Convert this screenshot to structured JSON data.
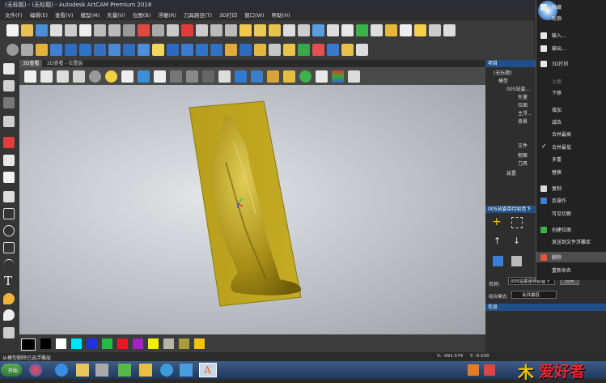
{
  "window": {
    "title": "(无标题) - (无标题) - Autodesk ArtCAM Premium 2018"
  },
  "menu": [
    "文件(F)",
    "编辑(E)",
    "查看(V)",
    "模型(M)",
    "矢量(V)",
    "位图(B)",
    "浮雕(R)",
    "刀具路径(T)",
    "3D打印",
    "窗口(W)",
    "帮助(H)"
  ],
  "view_tabs": [
    "3D查看",
    "2D查看 - 位置层"
  ],
  "left_tool_icons": [
    "select-arrow-icon",
    "node-edit-icon",
    "transform-icon",
    "grid-icon",
    "pen-icon",
    "eraser-icon",
    "camera-icon",
    "arc-icon",
    "rectangle-icon",
    "ellipse-icon",
    "polygon-icon",
    "curve-icon",
    "text-icon",
    "fill-icon",
    "drop-icon",
    "brush-icon"
  ],
  "palette": {
    "colors": [
      "#000000",
      "#ffffff",
      "#00e5ff",
      "#2233dd",
      "#22bb44",
      "#e21b22",
      "#a521c4",
      "#f2ee00",
      "#b8b4a8",
      "#a89c3c",
      "#f0c400"
    ]
  },
  "status": {
    "left": "从模型删除已选浮雕层",
    "coords": "X: -091.574     Y: -0.030"
  },
  "project_panel": {
    "title": "项目",
    "items": [
      "(无标题)",
      "模型",
      "005站姿...",
      "矢量",
      "位图",
      "主浮...",
      "背景",
      "文件",
      "侧面",
      "刀具",
      "装置"
    ]
  },
  "relief_panel": {
    "title": "005站姿苗侍如音下",
    "name_label": "名称:",
    "name_value": "005站姿苗侍如音下",
    "apply_button": "应用",
    "combine_label": "组合模式:",
    "combine_value": "合并最低"
  },
  "info_panel": {
    "title": "信息"
  },
  "context_menu": [
    {
      "label": "隐藏",
      "icon": "hide-icon"
    },
    {
      "label": "轮廓",
      "icon": "outline-icon"
    },
    {
      "label": "输入...",
      "icon": "import-icon"
    },
    {
      "label": "输出...",
      "icon": "export-icon"
    },
    {
      "label": "3D打印",
      "icon": "3d-print-icon"
    },
    {
      "label": "上移",
      "icon": "",
      "disabled": true
    },
    {
      "label": "下移",
      "icon": ""
    },
    {
      "label": "增加",
      "icon": ""
    },
    {
      "label": "减去",
      "icon": ""
    },
    {
      "label": "合并最高",
      "icon": ""
    },
    {
      "label": "合并最低",
      "icon": "check-icon"
    },
    {
      "label": "多重",
      "icon": ""
    },
    {
      "label": "替换",
      "icon": ""
    },
    {
      "label": "复制",
      "icon": "copy-icon"
    },
    {
      "label": "反操作",
      "icon": "invert-icon"
    },
    {
      "label": "可见切换",
      "icon": ""
    },
    {
      "label": "创建位图",
      "icon": "bitmap-icon"
    },
    {
      "label": "发送到文件浮雕库",
      "icon": "library-icon"
    },
    {
      "label": "删除",
      "icon": "delete-icon",
      "highlighted": true
    },
    {
      "label": "重新命名",
      "icon": ""
    }
  ],
  "taskbar": {
    "start": "开始"
  },
  "watermark": {
    "text": "爱好者"
  }
}
